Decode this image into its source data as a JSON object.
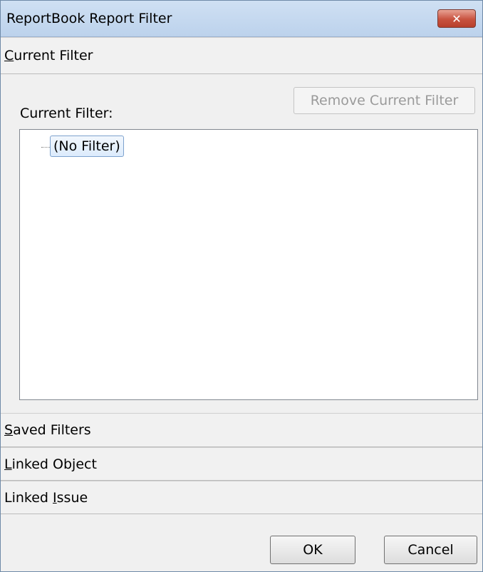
{
  "window": {
    "title": "ReportBook Report Filter",
    "close_glyph": "✕"
  },
  "sections": {
    "current_filter": {
      "label_accel": "C",
      "label_rest": "urrent Filter"
    },
    "saved_filters": {
      "label_accel": "S",
      "label_rest": "aved Filters"
    },
    "linked_object": {
      "label_accel": "L",
      "label_rest": "inked Object"
    },
    "linked_issue": {
      "label_pre": "Linked ",
      "label_accel": "I",
      "label_rest": "ssue"
    }
  },
  "current_filter_panel": {
    "remove_button_label": "Remove Current Filter",
    "field_label": "Current Filter:",
    "tree": {
      "root_node_label": "(No Filter)"
    }
  },
  "buttons": {
    "ok_label": "OK",
    "cancel_label": "Cancel"
  },
  "colors": {
    "title_bar": "#c6daf1",
    "close_button": "#c8523e",
    "tree_selection": "#dcebfc",
    "disabled_text": "#9a9a9a"
  },
  "icons": {
    "close": "close-icon",
    "tree_connector": "tree-connector-icon"
  }
}
